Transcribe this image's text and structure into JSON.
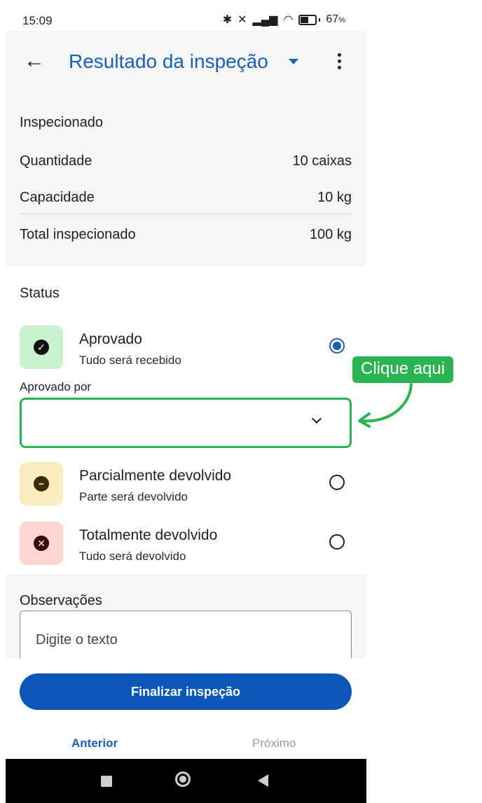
{
  "status_bar": {
    "time": "15:09",
    "battery": "67",
    "battery_unit": "%",
    "battery_level": 0.67
  },
  "app_bar": {
    "title": "Resultado da inspeção"
  },
  "inspected": {
    "heading": "Inspecionado",
    "rows": [
      {
        "label": "Quantidade",
        "value": "10 caixas"
      },
      {
        "label": "Capacidade",
        "value": "10 kg"
      },
      {
        "label": "Total inspecionado",
        "value": "100 kg"
      }
    ]
  },
  "status": {
    "heading": "Status",
    "options": [
      {
        "label": "Aprovado",
        "sub": "Tudo será recebido",
        "selected": true,
        "color": "#c9f2cf",
        "icon": "check-circle-icon"
      },
      {
        "label": "Parcialmente devolvido",
        "sub": "Parte será devolvido",
        "selected": false,
        "color": "#fbecc0",
        "icon": "minus-circle-icon"
      },
      {
        "label": "Totalmente devolvido",
        "sub": "Tudo será devolvido",
        "selected": false,
        "color": "#ffd5d2",
        "icon": "x-circle-icon"
      }
    ],
    "approved_by_label": "Aprovado por",
    "approved_by_value": ""
  },
  "observations": {
    "heading": "Observações",
    "placeholder": "Digite o texto"
  },
  "actions": {
    "finish": "Finalizar inspeção",
    "previous": "Anterior",
    "next": "Próximo"
  },
  "annotation": {
    "callout": "Clique aqui",
    "color": "#2bb352"
  },
  "colors": {
    "accent": "#1a5fb4",
    "primary_button": "#0a57b8"
  }
}
